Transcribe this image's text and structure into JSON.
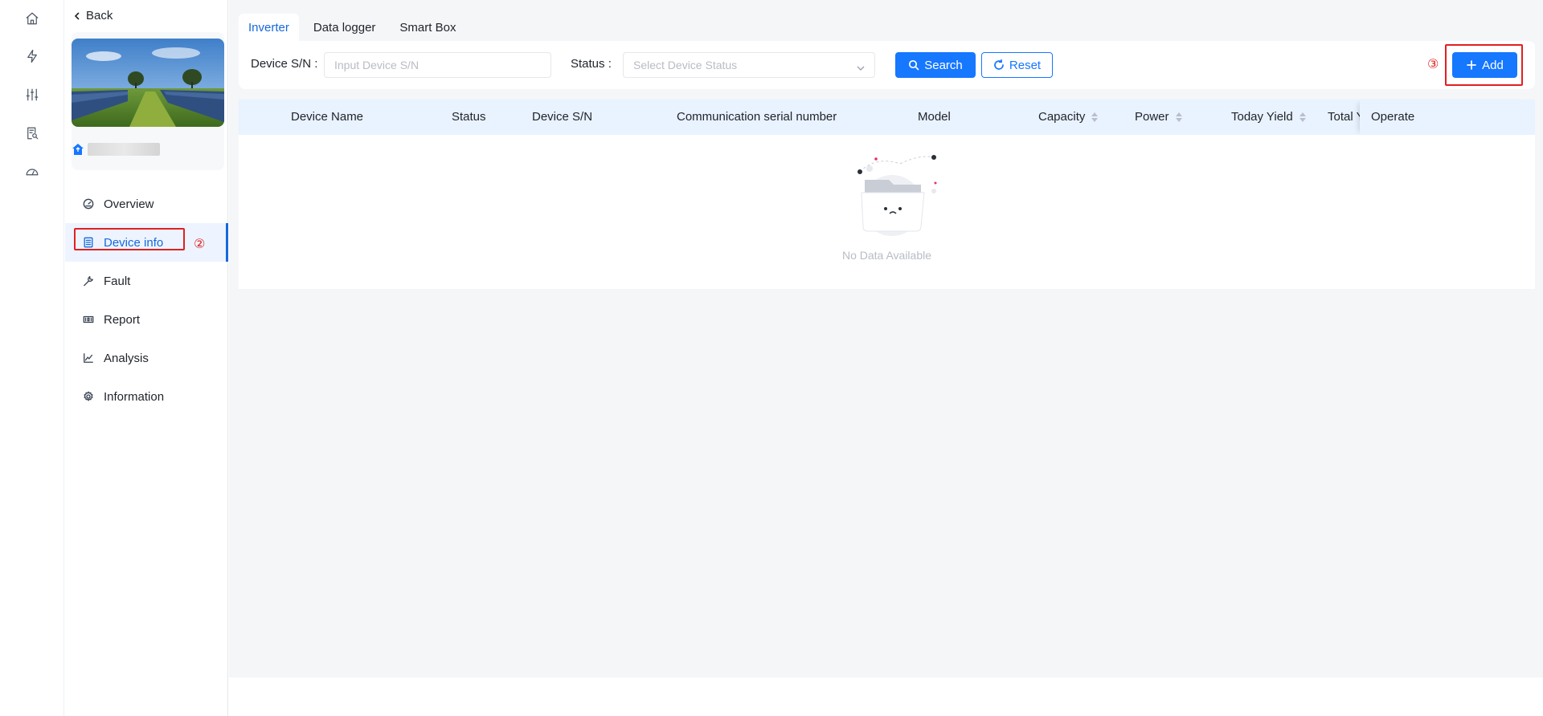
{
  "rail": {
    "items": [
      {
        "name": "home-icon"
      },
      {
        "name": "lightning-icon"
      },
      {
        "name": "sliders-icon"
      },
      {
        "name": "report-search-icon"
      },
      {
        "name": "gauge-icon"
      }
    ]
  },
  "sidebar": {
    "back_label": "Back",
    "nav": [
      {
        "label": "Overview",
        "icon": "gauge-icon"
      },
      {
        "label": "Device info",
        "icon": "list-icon"
      },
      {
        "label": "Fault",
        "icon": "wrench-icon"
      },
      {
        "label": "Report",
        "icon": "report-icon"
      },
      {
        "label": "Analysis",
        "icon": "line-chart-icon"
      },
      {
        "label": "Information",
        "icon": "gear-icon"
      }
    ],
    "active": "Device info"
  },
  "tabs": [
    {
      "label": "Inverter",
      "active": true
    },
    {
      "label": "Data logger",
      "active": false
    },
    {
      "label": "Smart Box",
      "active": false
    }
  ],
  "filters": {
    "sn_label": "Device S/N :",
    "sn_placeholder": "Input Device S/N",
    "status_label": "Status :",
    "status_placeholder": "Select Device Status",
    "search_label": "Search",
    "reset_label": "Reset",
    "add_label": "Add"
  },
  "table": {
    "columns": [
      {
        "label": "Device Name",
        "sortable": false
      },
      {
        "label": "Status",
        "sortable": false
      },
      {
        "label": "Device S/N",
        "sortable": false
      },
      {
        "label": "Communication serial number",
        "sortable": false
      },
      {
        "label": "Model",
        "sortable": false
      },
      {
        "label": "Capacity",
        "sortable": true
      },
      {
        "label": "Power",
        "sortable": true
      },
      {
        "label": "Today Yield",
        "sortable": true
      },
      {
        "label": "Total Y",
        "sortable": false
      },
      {
        "label": "Operate",
        "sortable": false
      }
    ],
    "empty_text": "No Data Available"
  },
  "annotations": {
    "step2": "②",
    "step3": "③",
    "color": "#e02020"
  },
  "colors": {
    "primary": "#1677ff",
    "active_text": "#1668dc",
    "header_bg": "#e9f2ff",
    "page_bg": "#f5f6f8"
  }
}
